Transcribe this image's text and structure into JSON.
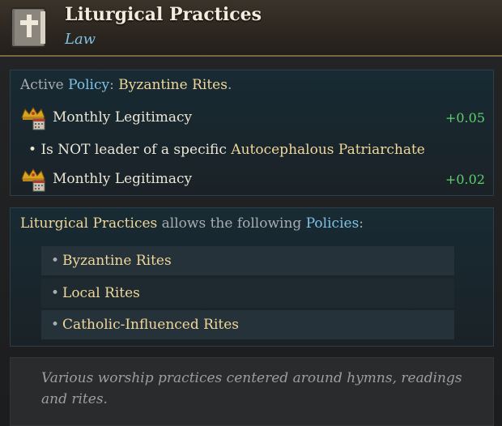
{
  "header": {
    "icon": "bible-icon",
    "title": "Liturgical Practices",
    "subtitle": "Law"
  },
  "active_policy": {
    "prefix": "Active ",
    "policy_word": "Policy",
    "colon": ": ",
    "value": "Byzantine Rites",
    "period": "."
  },
  "modifiers": [
    {
      "icon": "crown-legitimacy-icon",
      "label": "Monthly Legitimacy",
      "value": "+0.05"
    },
    {
      "icon": "crown-legitimacy-icon",
      "label": "Monthly Legitimacy",
      "value": "+0.02"
    }
  ],
  "condition": {
    "bullet": "•",
    "text": "Is NOT leader of a specific ",
    "highlight": "Autocephalous Patriarchate"
  },
  "allows": {
    "law": "Liturgical Practices",
    "middle": " allows the following ",
    "policies_word": "Policies",
    "colon": ":",
    "items": [
      "Byzantine Rites",
      "Local Rites",
      "Catholic-Influenced Rites"
    ],
    "bullet": "•"
  },
  "description": "Various worship practices centered around hymns, readings and rites.",
  "colors": {
    "gold": "#f0d79a",
    "blue": "#7fc3e6",
    "positive": "#5fcf6e",
    "header_border": "#7a6640"
  }
}
